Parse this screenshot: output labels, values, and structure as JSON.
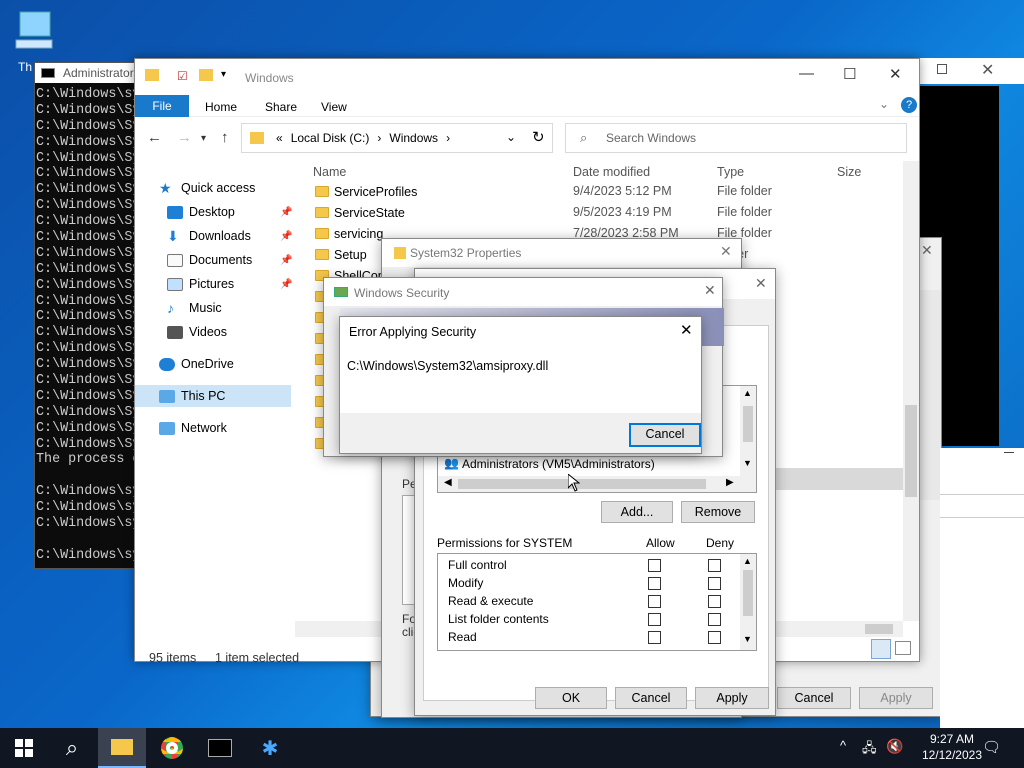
{
  "desktop": {
    "icon_label": "Th"
  },
  "console": {
    "title": "Administrator",
    "lines": [
      "C:\\Windows\\sy",
      "C:\\Windows\\Sy",
      "C:\\Windows\\Sy",
      "C:\\Windows\\Sy",
      "C:\\Windows\\Sy",
      "C:\\Windows\\Sy",
      "C:\\Windows\\Sy",
      "C:\\Windows\\Sy",
      "C:\\Windows\\Sy",
      "C:\\Windows\\Sy",
      "C:\\Windows\\Sy",
      "C:\\Windows\\Sy",
      "C:\\Windows\\Sy",
      "C:\\Windows\\Sy",
      "C:\\Windows\\Sy",
      "C:\\Windows\\Sy",
      "C:\\Windows\\Sy",
      "C:\\Windows\\Sy",
      "C:\\Windows\\Sy",
      "C:\\Windows\\Sy",
      "C:\\Windows\\Sy",
      "C:\\Windows\\Sy",
      "C:\\Windows\\Sy",
      "The process c",
      "",
      "C:\\Windows\\sy",
      "C:\\Windows\\sy",
      "C:\\Windows\\sy",
      "",
      "C:\\Windows\\sy"
    ]
  },
  "explorer": {
    "title": "Windows",
    "ribbon": {
      "file": "File",
      "home": "Home",
      "share": "Share",
      "view": "View"
    },
    "address": {
      "prefix": "«",
      "drive": "Local Disk (C:)",
      "sep": "›",
      "folder": "Windows",
      "sep2": "›"
    },
    "search_placeholder": "Search Windows",
    "columns": {
      "name": "Name",
      "date": "Date modified",
      "type": "Type",
      "size": "Size"
    },
    "sidebar": {
      "quick": "Quick access",
      "desktop": "Desktop",
      "downloads": "Downloads",
      "documents": "Documents",
      "pictures": "Pictures",
      "music": "Music",
      "videos": "Videos",
      "onedrive": "OneDrive",
      "thispc": "This PC",
      "network": "Network"
    },
    "files": [
      {
        "name": "ServiceProfiles",
        "date": "9/4/2023 5:12 PM",
        "type": "File folder"
      },
      {
        "name": "ServiceState",
        "date": "9/5/2023 4:19 PM",
        "type": "File folder"
      },
      {
        "name": "servicing",
        "date": "7/28/2023 2:58 PM",
        "type": "File folder"
      },
      {
        "name": "Setup",
        "date": "",
        "type": "folder"
      },
      {
        "name": "ShellCom",
        "date": "",
        "type": ""
      },
      {
        "name": "SystemRe",
        "date": "",
        "type": ""
      },
      {
        "name": "SystemTe",
        "date": "",
        "type": ""
      },
      {
        "name": "SysWOW",
        "date": "",
        "type": ""
      },
      {
        "name": "TAPI",
        "date": "",
        "type": ""
      },
      {
        "name": "Tasks",
        "date": "",
        "type": ""
      },
      {
        "name": "Temp",
        "date": "",
        "type": ""
      },
      {
        "name": "tracing",
        "date": "",
        "type": ""
      },
      {
        "name": "twain_32",
        "date": "",
        "type": ""
      }
    ],
    "status_items": "95 items",
    "status_selected": "1 item selected"
  },
  "props": {
    "title": "System32 Properties",
    "perm_partial": "Pe",
    "for_partial": "For",
    "cli_partial": "clic",
    "ok": "OK",
    "cancel": "Cancel",
    "apply": "Apply"
  },
  "security": {
    "title": "Windows Security",
    "group_user": "Administrators (VM5\\Administrators)",
    "add": "Add...",
    "remove": "Remove",
    "perm_for": "Permissions for SYSTEM",
    "allow": "Allow",
    "deny": "Deny",
    "perms": [
      "Full control",
      "Modify",
      "Read & execute",
      "List folder contents",
      "Read"
    ],
    "ok": "OK",
    "cancel": "Cancel",
    "apply": "Apply"
  },
  "error": {
    "title": "Error Applying Security",
    "path": "C:\\Windows\\System32\\amsiproxy.dll",
    "cancel": "Cancel"
  },
  "back_dialog": {
    "cancel": "Cancel",
    "apply": "Apply"
  },
  "taskbar": {
    "time": "9:27 AM",
    "date": "12/12/2023"
  }
}
